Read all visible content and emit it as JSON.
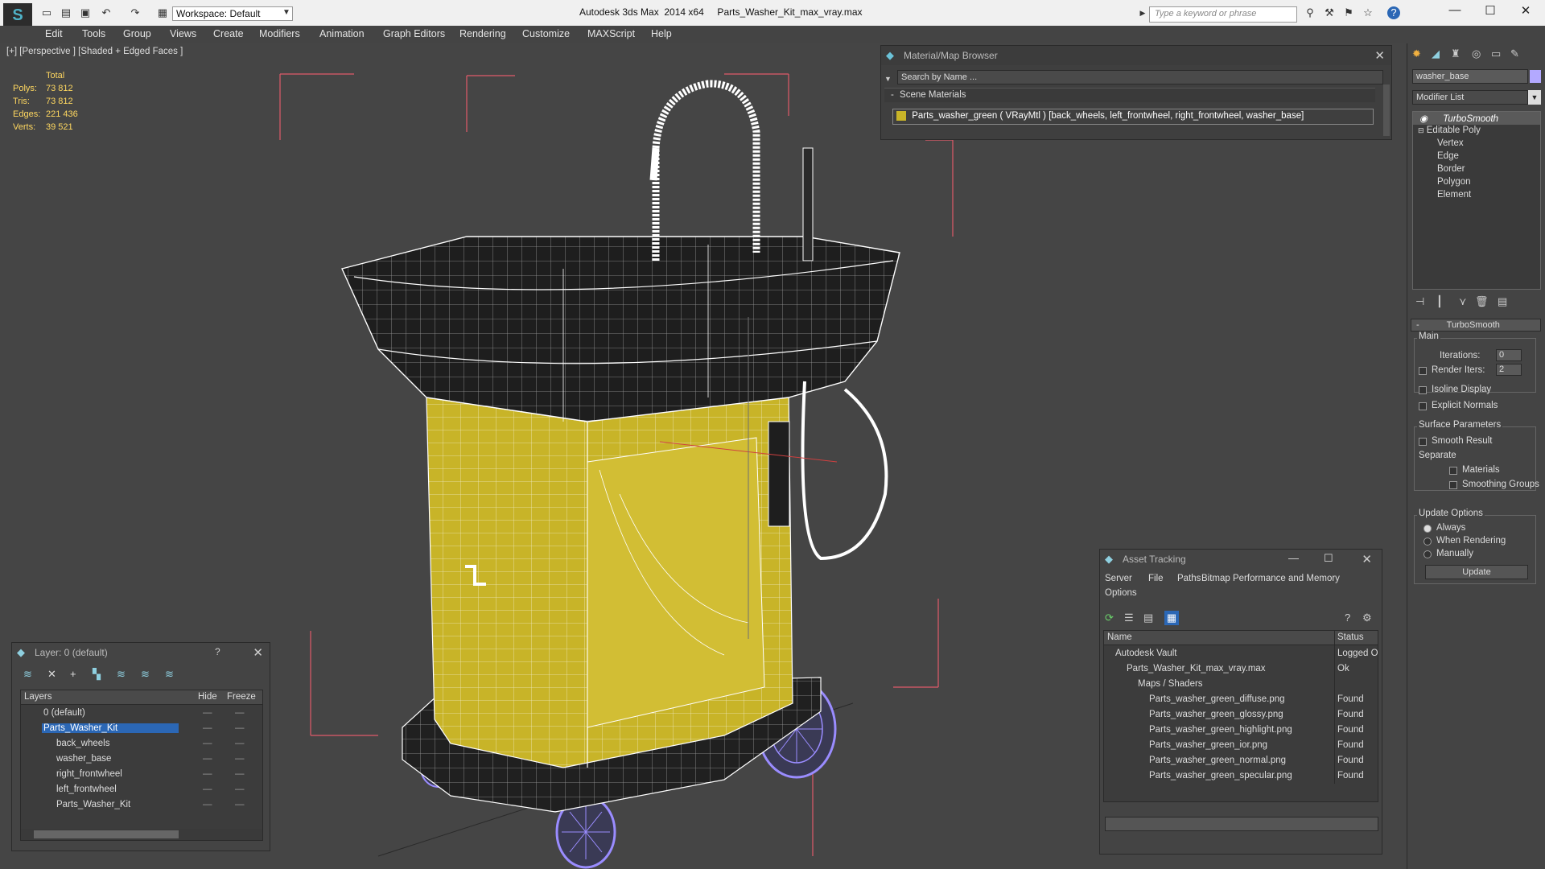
{
  "app": {
    "title": "Autodesk 3ds Max  2014 x64     Parts_Washer_Kit_max_vray.max",
    "workspace": "Workspace: Default",
    "search_placeholder": "Type a keyword or phrase"
  },
  "menu": [
    "Edit",
    "Tools",
    "Group",
    "Views",
    "Create",
    "Modifiers",
    "Animation",
    "Graph Editors",
    "Rendering",
    "Customize",
    "MAXScript",
    "Help"
  ],
  "viewport": {
    "label": "[+] [Perspective ] [Shaded + Edged Faces ]",
    "stats": {
      "header": "Total",
      "rows": [
        {
          "label": "Polys:",
          "value": "73 812"
        },
        {
          "label": "Tris:",
          "value": "73 812"
        },
        {
          "label": "Edges:",
          "value": "221 436"
        },
        {
          "label": "Verts:",
          "value": "39 521"
        }
      ]
    },
    "colors": {
      "wire": "#ffffff",
      "body": "#c8b428",
      "wheels": "#9a8cff",
      "bbox": "#e05a6a"
    }
  },
  "material_browser": {
    "title": "Material/Map Browser",
    "search": "Search by Name ...",
    "group": "Scene Materials",
    "item": "Parts_washer_green  ( VRayMtl )  [back_wheels, left_frontwheel, right_frontwheel, washer_base]"
  },
  "command_panel": {
    "object_name": "washer_base",
    "modifier_list": "Modifier List",
    "stack": [
      {
        "label": "TurboSmooth",
        "level": 0
      },
      {
        "label": "Editable Poly",
        "level": 0
      },
      {
        "label": "Vertex",
        "level": 1
      },
      {
        "label": "Edge",
        "level": 1
      },
      {
        "label": "Border",
        "level": 1
      },
      {
        "label": "Polygon",
        "level": 1
      },
      {
        "label": "Element",
        "level": 1
      }
    ],
    "rollout_title": "TurboSmooth",
    "main_label": "Main",
    "iterations_label": "Iterations:",
    "iterations_value": "0",
    "render_iters_label": "Render Iters:",
    "render_iters_value": "2",
    "isoline": "Isoline Display",
    "explicit_normals": "Explicit Normals",
    "surface_params": "Surface Parameters",
    "smooth_result": "Smooth Result",
    "separate": "Separate",
    "materials": "Materials",
    "smoothing_groups": "Smoothing Groups",
    "update_options": "Update Options",
    "always": "Always",
    "when_rendering": "When Rendering",
    "manually": "Manually",
    "update_button": "Update"
  },
  "asset_tracking": {
    "title": "Asset Tracking",
    "menu": [
      "Server",
      "File",
      "Paths",
      "Bitmap Performance and Memory",
      "Options"
    ],
    "col_name": "Name",
    "col_status": "Status",
    "rows": [
      {
        "name": "Autodesk Vault",
        "status": "Logged O",
        "indent": 1
      },
      {
        "name": "Parts_Washer_Kit_max_vray.max",
        "status": "Ok",
        "indent": 2
      },
      {
        "name": "Maps / Shaders",
        "status": "",
        "indent": 3
      },
      {
        "name": "Parts_washer_green_diffuse.png",
        "status": "Found",
        "indent": 4
      },
      {
        "name": "Parts_washer_green_glossy.png",
        "status": "Found",
        "indent": 4
      },
      {
        "name": "Parts_washer_green_highlight.png",
        "status": "Found",
        "indent": 4
      },
      {
        "name": "Parts_washer_green_ior.png",
        "status": "Found",
        "indent": 4
      },
      {
        "name": "Parts_washer_green_normal.png",
        "status": "Found",
        "indent": 4
      },
      {
        "name": "Parts_washer_green_specular.png",
        "status": "Found",
        "indent": 4
      }
    ]
  },
  "layers": {
    "title": "Layer: 0 (default)",
    "help": "?",
    "col_layers": "Layers",
    "col_hide": "Hide",
    "col_freeze": "Freeze",
    "rows": [
      {
        "name": "0 (default)",
        "indent": 1,
        "selected": false
      },
      {
        "name": "Parts_Washer_Kit",
        "indent": 1,
        "selected": true
      },
      {
        "name": "back_wheels",
        "indent": 2,
        "selected": false
      },
      {
        "name": "washer_base",
        "indent": 2,
        "selected": false
      },
      {
        "name": "right_frontwheel",
        "indent": 2,
        "selected": false
      },
      {
        "name": "left_frontwheel",
        "indent": 2,
        "selected": false
      },
      {
        "name": "Parts_Washer_Kit",
        "indent": 2,
        "selected": false
      }
    ]
  }
}
